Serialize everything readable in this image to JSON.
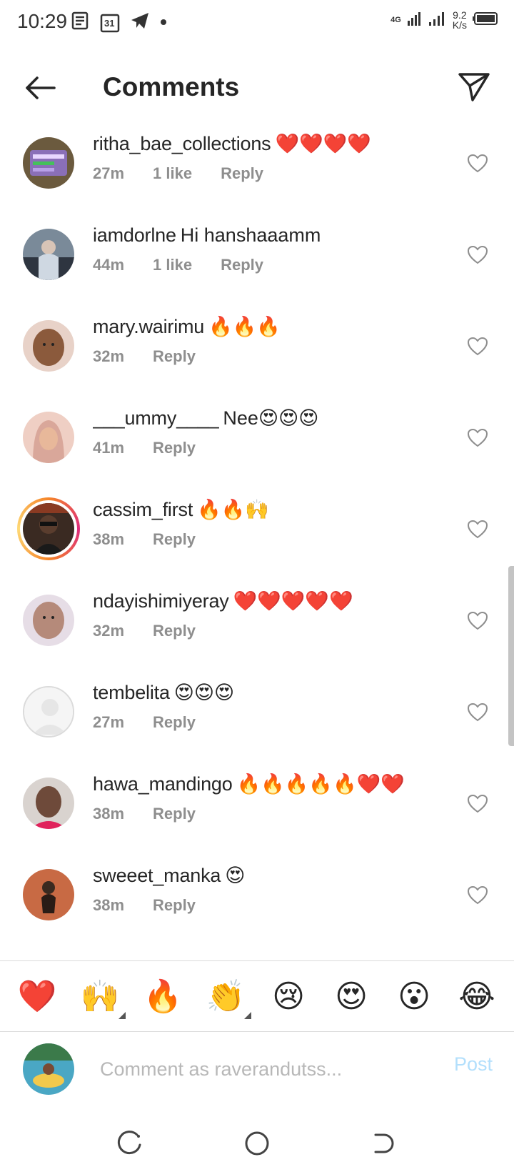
{
  "status": {
    "time": "10:29",
    "network": "4G",
    "speed_value": "9.2",
    "speed_unit": "K/s",
    "left_icons": [
      "news-icon",
      "calendar-icon",
      "telegram-icon",
      "dot-icon"
    ],
    "calendar_day": "31"
  },
  "header": {
    "title": "Comments"
  },
  "comments": [
    {
      "username": "ritha_bae_collections",
      "text": "❤️❤️❤️❤️",
      "time": "27m",
      "likes": "1 like",
      "reply": "Reply",
      "avatar_color": "#6b5a3e"
    },
    {
      "username": "iamdorlne",
      "text": "Hi hanshaaamm",
      "time": "44m",
      "likes": "1 like",
      "reply": "Reply",
      "avatar_color": "#7a8a99"
    },
    {
      "username": "mary.wairimu",
      "text": "🔥🔥🔥",
      "time": "32m",
      "likes": "",
      "reply": "Reply",
      "avatar_color": "#8b5a3c"
    },
    {
      "username": "___ummy____",
      "text": "Nee😍😍😍",
      "time": "41m",
      "likes": "",
      "reply": "Reply",
      "avatar_color": "#d9a79a"
    },
    {
      "username": "cassim_first",
      "text": "🔥🔥🙌",
      "time": "38m",
      "likes": "",
      "reply": "Reply",
      "avatar_color": "#3a2a22"
    },
    {
      "username": "ndayishimiyeray",
      "text": "❤️❤️❤️❤️❤️",
      "time": "32m",
      "likes": "",
      "reply": "Reply",
      "avatar_color": "#b58a7a"
    },
    {
      "username": "tembelita",
      "text": "😍😍😍",
      "time": "27m",
      "likes": "",
      "reply": "Reply",
      "avatar_color": "#e6e6e6"
    },
    {
      "username": "hawa_mandingo",
      "text": "🔥🔥🔥🔥🔥❤️❤️",
      "time": "38m",
      "likes": "",
      "reply": "Reply",
      "avatar_color": "#6e4a3a"
    },
    {
      "username": "sweeet_manka",
      "text": "😍",
      "time": "38m",
      "likes": "",
      "reply": "Reply",
      "avatar_color": "#c86a44"
    }
  ],
  "emoji_bar": [
    "❤️",
    "🙌",
    "🔥",
    "👏",
    "😢",
    "😍",
    "😮",
    "😂"
  ],
  "composer": {
    "placeholder": "Comment as raverandutss...",
    "post_label": "Post"
  }
}
